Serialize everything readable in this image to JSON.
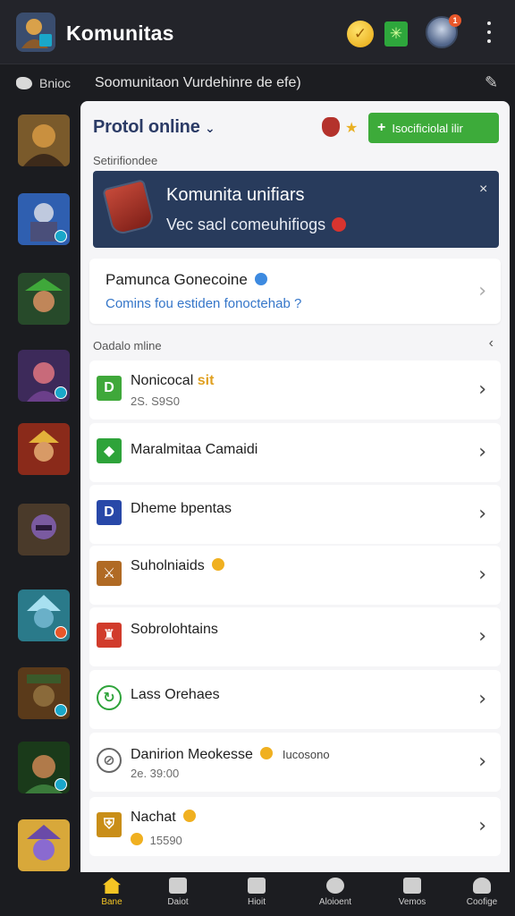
{
  "topbar": {
    "title": "Komunitas",
    "coin_glyph": "✓",
    "gem_glyph": "✳",
    "avatar_badge": "1"
  },
  "rail": {
    "header_label": "Bnioc",
    "item_count": 10
  },
  "subbar": {
    "text": "Soomunitaon Vurdehinre de efe)"
  },
  "panel": {
    "brand": "Protol online",
    "brand_chevron": "⌄",
    "action_button_label": "Isocificiolal ilir",
    "section1_label": "Setirifiondee",
    "banner": {
      "title": "Komunita unifiars",
      "subtitle": "Vec sacl comeuhifiogs",
      "close": "×"
    },
    "info_card": {
      "title": "Pamunca Gonecoine",
      "subtitle": "Comins fou estiden fonoctehab ?"
    },
    "section2_label": "Oadalo mline",
    "list": [
      {
        "title": "Nonicocal",
        "badge": "sit",
        "sub": "2S. S9S0",
        "icon_glyph": "D",
        "icon_color": "#3fa83a"
      },
      {
        "title": "Maralmitaa Camaidi",
        "badge": "",
        "sub": "",
        "icon_glyph": "◆",
        "icon_color": "#2ea33a"
      },
      {
        "title": "Dheme bpentas",
        "badge": "",
        "sub": "",
        "icon_glyph": "D",
        "icon_color": "#2848a8"
      },
      {
        "title": "Suholniaids",
        "badge": "",
        "sub": "",
        "icon_glyph": "⚔",
        "icon_color": "#b06a24"
      },
      {
        "title": "Sobrolohtains",
        "badge": "",
        "sub": "",
        "icon_glyph": "♜",
        "icon_color": "#d13b2b"
      },
      {
        "title": "Lass Orehaes",
        "badge": "",
        "sub": "",
        "icon_glyph": "↻",
        "icon_color": "#2ea33a"
      },
      {
        "title": "Danirion Meokesse",
        "badge": "",
        "meta": "Iucosono",
        "sub": "2e. 39:00",
        "icon_glyph": "⊘",
        "icon_color": "#666666"
      },
      {
        "title": "Nachat",
        "badge": "",
        "sub": "15590",
        "icon_glyph": "⛨",
        "icon_color": "#c98e18"
      }
    ]
  },
  "bottomnav": [
    {
      "label": "Bane",
      "active": true
    },
    {
      "label": "Daiot",
      "active": false
    },
    {
      "label": "Hioit",
      "active": false
    },
    {
      "label": "Aloioent",
      "active": false
    },
    {
      "label": "Vemos",
      "active": false
    },
    {
      "label": "Coofige",
      "active": false
    }
  ],
  "colors": {
    "accent_green": "#3dab3a",
    "banner_bg": "#283b5c",
    "active_nav": "#f4c524"
  }
}
